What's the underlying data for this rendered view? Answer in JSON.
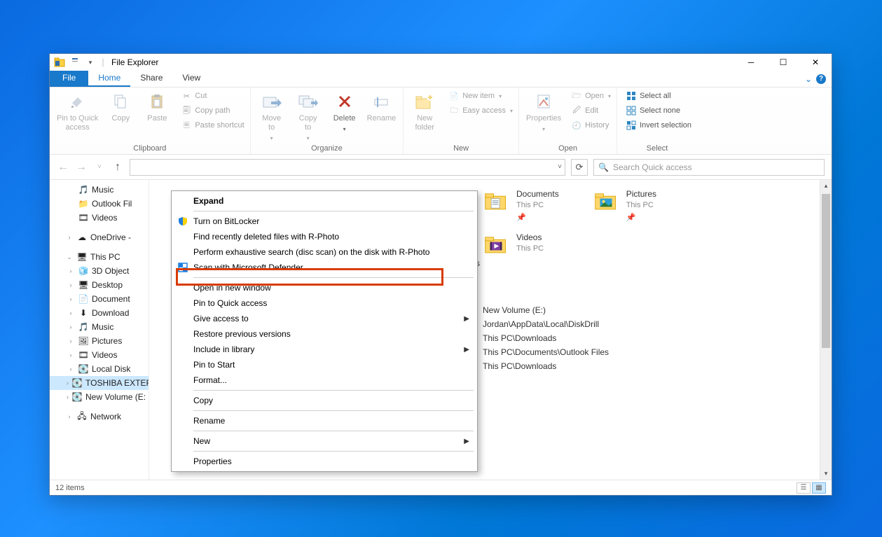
{
  "titlebar": {
    "title": "File Explorer"
  },
  "window_controls": {
    "minimize": "─",
    "maximize": "☐",
    "close": "✕"
  },
  "tabs": {
    "file": "File",
    "home": "Home",
    "share": "Share",
    "view": "View",
    "chevron": "⌄",
    "help": "?"
  },
  "ribbon": {
    "clipboard": {
      "pin": "Pin to Quick\naccess",
      "copy": "Copy",
      "paste": "Paste",
      "cut": "Cut",
      "copy_path": "Copy path",
      "paste_shortcut": "Paste shortcut",
      "label": "Clipboard"
    },
    "organize": {
      "move_to": "Move\nto",
      "copy_to": "Copy\nto",
      "delete": "Delete",
      "rename": "Rename",
      "label": "Organize"
    },
    "new": {
      "new_folder": "New\nfolder",
      "new_item": "New item",
      "easy_access": "Easy access",
      "label": "New"
    },
    "open": {
      "properties": "Properties",
      "open": "Open",
      "edit": "Edit",
      "history": "History",
      "label": "Open"
    },
    "select": {
      "select_all": "Select all",
      "select_none": "Select none",
      "invert": "Invert selection",
      "label": "Select"
    }
  },
  "addressbar": {
    "refresh_tip": "⟳"
  },
  "search": {
    "placeholder": "Search Quick access"
  },
  "tree": {
    "music": "Music",
    "outlook": "Outlook Fil",
    "videos": "Videos",
    "onedrive": "OneDrive -",
    "thispc": "This PC",
    "objects3d": "3D Object",
    "desktop": "Desktop",
    "documents": "Document",
    "downloads": "Download",
    "music2": "Music",
    "pictures": "Pictures",
    "videos2": "Videos",
    "localdisk": "Local Disk",
    "toshiba": "TOSHIBA EXTERN",
    "newvolume": "New Volume (E:",
    "network": "Network"
  },
  "content_right": {
    "documents": "Documents",
    "documents_sub": "This PC",
    "pictures": "Pictures",
    "pictures_sub": "This PC",
    "videos": "Videos",
    "videos_sub": "This PC",
    "frc_ments": "ments",
    "recent1": "New Volume (E:)",
    "recent2": "Jordan\\AppData\\Local\\DiskDrill",
    "recent3": "This PC\\Downloads",
    "recent4": "This PC\\Documents\\Outlook Files",
    "recent5": "This PC\\Downloads"
  },
  "context_menu": {
    "expand": "Expand",
    "bitlocker": "Turn on BitLocker",
    "rphoto1": "Find recently deleted files with R-Photo",
    "rphoto2": "Perform exhaustive search (disc scan) on the disk with R-Photo",
    "defender": "Scan with Microsoft Defender...",
    "open_new": "Open in new window",
    "pin_quick": "Pin to Quick access",
    "give_access": "Give access to",
    "restore": "Restore previous versions",
    "include": "Include in library",
    "pin_start": "Pin to Start",
    "format": "Format...",
    "copy": "Copy",
    "rename": "Rename",
    "new": "New",
    "properties": "Properties"
  },
  "statusbar": {
    "items": "12 items"
  }
}
